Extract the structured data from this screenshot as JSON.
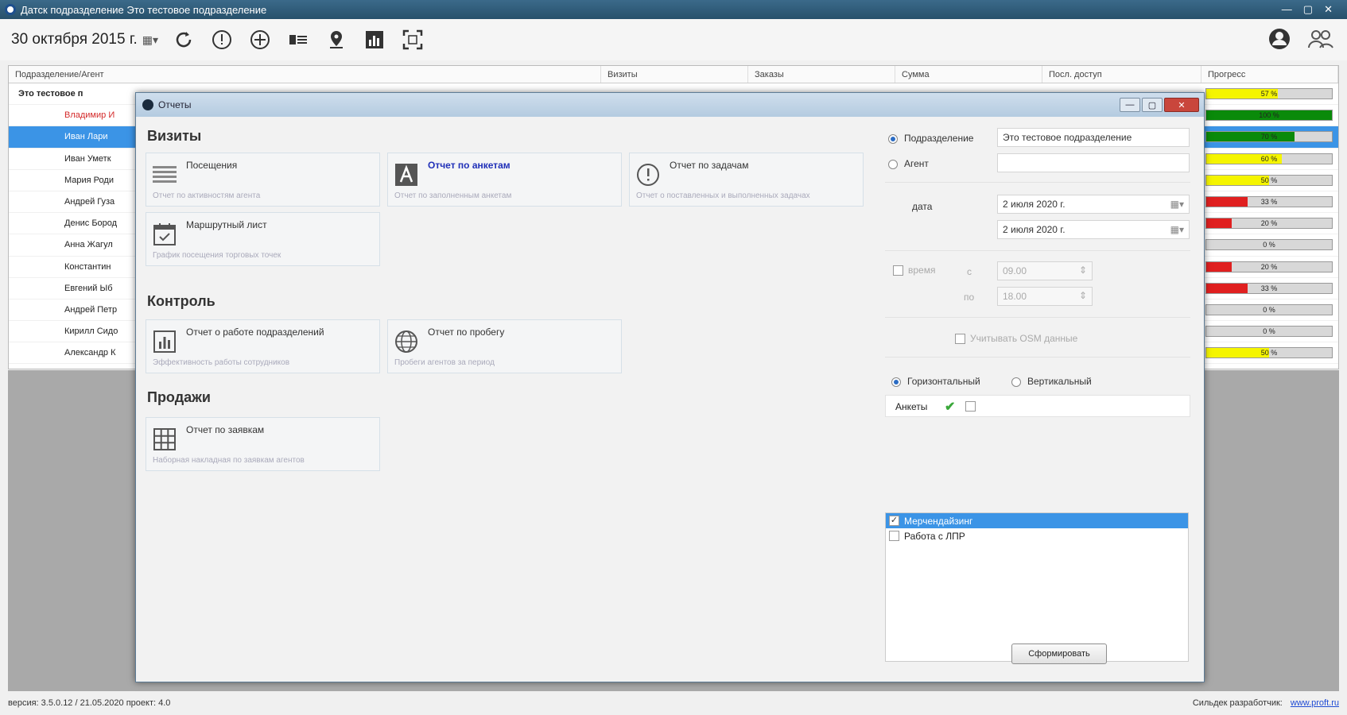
{
  "window": {
    "title": "Датск подразделение Это тестовое подразделение",
    "buttons": [
      "—",
      "▢",
      "✕"
    ]
  },
  "toolbar": {
    "date_label": "30 октября 2015 г.",
    "icons": [
      "refresh-icon",
      "alert-icon",
      "add-icon",
      "list-icon",
      "location-icon",
      "chart-icon",
      "fullscreen-icon"
    ],
    "right_icons": [
      "user-icon",
      "users-icon"
    ]
  },
  "grid": {
    "headers": [
      "Подразделение/Агент",
      "Визиты",
      "Заказы",
      "Сумма",
      "Посл. доступ",
      "Прогресс"
    ],
    "rows": [
      {
        "name": "Это тестовое п",
        "progress": 57,
        "progress_label": "57 %",
        "color": "#f5f500",
        "kind": "root"
      },
      {
        "name": "Владимир И",
        "progress": 100,
        "progress_label": "100 %",
        "color": "#0a8a0a",
        "kind": "red"
      },
      {
        "name": "Иван Лари",
        "progress": 70,
        "progress_label": "70 %",
        "color": "#0a8a0a",
        "kind": "sel"
      },
      {
        "name": "Иван Уметк",
        "progress": 60,
        "progress_label": "60 %",
        "color": "#f5f500",
        "kind": ""
      },
      {
        "name": "Мария Роди",
        "progress": 50,
        "progress_label": "50 %",
        "color": "#f5f500",
        "kind": ""
      },
      {
        "name": "Андрей Гуза",
        "progress": 33,
        "progress_label": "33 %",
        "color": "#e02020",
        "kind": ""
      },
      {
        "name": "Денис Бород",
        "progress": 20,
        "progress_label": "20 %",
        "color": "#e02020",
        "kind": ""
      },
      {
        "name": "Анна Жагул",
        "progress": 0,
        "progress_label": "0 %",
        "color": "#e02020",
        "kind": ""
      },
      {
        "name": "Константин",
        "progress": 20,
        "progress_label": "20 %",
        "color": "#e02020",
        "kind": ""
      },
      {
        "name": "Евгений Ыб",
        "progress": 33,
        "progress_label": "33 %",
        "color": "#e02020",
        "kind": ""
      },
      {
        "name": "Андрей Петр",
        "progress": 0,
        "progress_label": "0 %",
        "color": "#e02020",
        "kind": ""
      },
      {
        "name": "Кирилл Сидо",
        "progress": 0,
        "progress_label": "0 %",
        "color": "#e02020",
        "kind": ""
      },
      {
        "name": "Александр К",
        "progress": 50,
        "progress_label": "50 %",
        "color": "#f5f500",
        "kind": ""
      }
    ]
  },
  "status": {
    "version": "версия: 3.5.0.12 / 21.05.2020 проект: 4.0",
    "developer_label": "Сильдек разработчик:",
    "developer_link": "www.proft.ru"
  },
  "dialog": {
    "title": "Отчеты",
    "sections": {
      "visits": "Визиты",
      "control": "Контроль",
      "sales": "Продажи"
    },
    "tiles": {
      "visits1": {
        "title": "Посещения",
        "desc": "Отчет по активностям агента",
        "icon": "list-icon"
      },
      "visits2": {
        "title": "Отчет по анкетам",
        "desc": "Отчет по заполненным анкетам",
        "icon": "form-icon"
      },
      "visits3": {
        "title": "Отчет по задачам",
        "desc": "Отчет о поставленных и выполненных задачах",
        "icon": "alert-icon"
      },
      "visits4": {
        "title": "Маршрутный лист",
        "desc": "График посещения торговых точек",
        "icon": "calendar-icon"
      },
      "control1": {
        "title": "Отчет о работе подразделений",
        "desc": "Эффективность работы сотрудников",
        "icon": "chart-icon"
      },
      "control2": {
        "title": "Отчет по пробегу",
        "desc": "Пробеги агентов за период",
        "icon": "globe-icon"
      },
      "sales1": {
        "title": "Отчет по заявкам",
        "desc": "Наборная накладная по заявкам агентов",
        "icon": "grid-icon"
      }
    },
    "filters": {
      "dept_label": "Подразделение",
      "dept_value": "Это тестовое подразделение",
      "agent_label": "Агент",
      "agent_value": "",
      "date_label": "дата",
      "date_from": "2   июля   2020 г.",
      "date_to": "2   июля   2020 г.",
      "time_label": "время",
      "time_from_label": "с",
      "time_from": "09.00",
      "time_to_label": "по",
      "time_to": "18.00",
      "osm_label": "Учитывать OSM данные",
      "horizontal_label": "Горизонтальный",
      "vertical_label": "Вертикальный",
      "surveys_label": "Анкеты",
      "list_items": [
        {
          "label": "Мерчендайзинг",
          "checked": true
        },
        {
          "label": "Работа с ЛПР",
          "checked": false
        }
      ],
      "generate_button": "Сформировать"
    }
  }
}
